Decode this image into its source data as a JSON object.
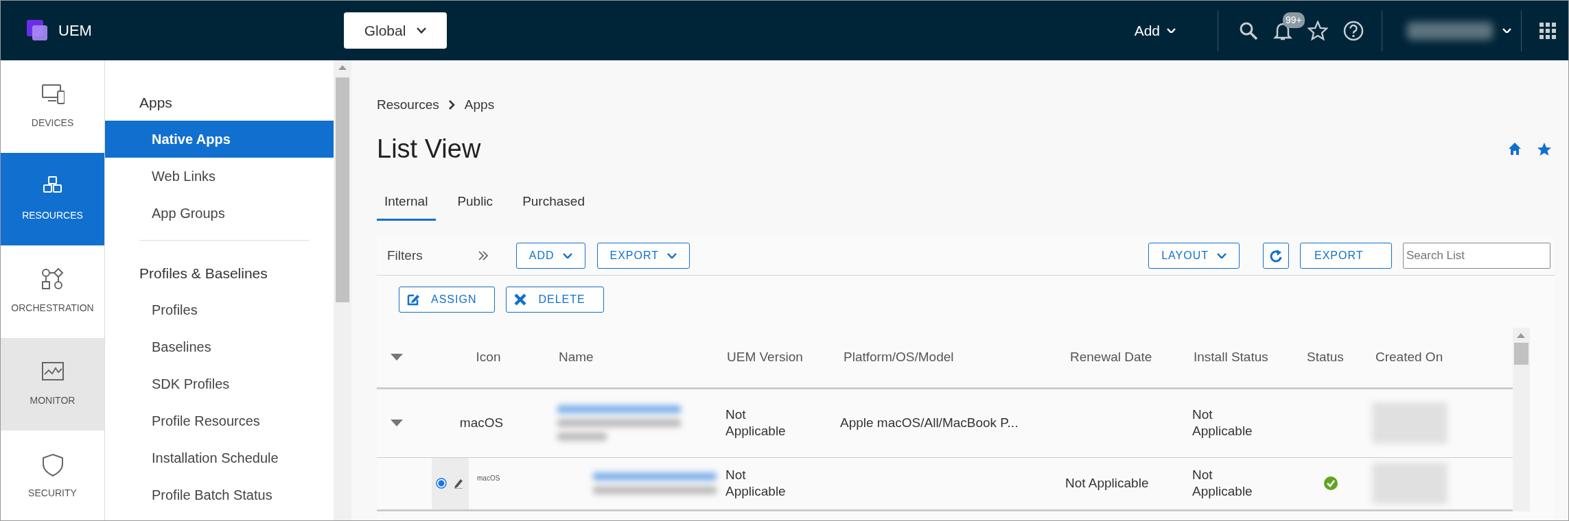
{
  "header": {
    "logo_text": "UEM",
    "scope": "Global",
    "add_menu": "Add",
    "notification_count": "99+"
  },
  "rail": [
    {
      "kind": "devices",
      "label": "DEVICES",
      "selected": false,
      "highlighted": false
    },
    {
      "kind": "resources",
      "label": "RESOURCES",
      "selected": true,
      "highlighted": false
    },
    {
      "kind": "orchestration",
      "label": "ORCHESTRATION",
      "selected": false,
      "highlighted": false
    },
    {
      "kind": "monitor",
      "label": "MONITOR",
      "selected": false,
      "highlighted": true
    },
    {
      "kind": "security",
      "label": "SECURITY",
      "selected": false,
      "highlighted": false
    }
  ],
  "submenu": [
    {
      "kind": "heading",
      "label": "Apps"
    },
    {
      "kind": "item",
      "label": "Native Apps",
      "selected": true
    },
    {
      "kind": "item",
      "label": "Web Links",
      "selected": false
    },
    {
      "kind": "item",
      "label": "App Groups",
      "selected": false
    },
    {
      "kind": "divider"
    },
    {
      "kind": "heading",
      "label": "Profiles & Baselines"
    },
    {
      "kind": "item",
      "label": "Profiles",
      "selected": false
    },
    {
      "kind": "item",
      "label": "Baselines",
      "selected": false
    },
    {
      "kind": "item",
      "label": "SDK Profiles",
      "selected": false
    },
    {
      "kind": "item",
      "label": "Profile Resources",
      "selected": false
    },
    {
      "kind": "item",
      "label": "Installation Schedule",
      "selected": false
    },
    {
      "kind": "item",
      "label": "Profile Batch Status",
      "selected": false
    }
  ],
  "breadcrumb": [
    "Resources",
    "Apps"
  ],
  "page_title": "List View",
  "tabs": [
    {
      "label": "Internal",
      "selected": true
    },
    {
      "label": "Public",
      "selected": false
    },
    {
      "label": "Purchased",
      "selected": false
    }
  ],
  "toolbar": {
    "filters_label": "Filters",
    "left_buttons": [
      {
        "kind": "dropdown",
        "label": "ADD"
      },
      {
        "kind": "dropdown",
        "label": "EXPORT"
      }
    ],
    "right_buttons": [
      {
        "kind": "dropdown",
        "label": "LAYOUT"
      },
      {
        "kind": "refresh"
      },
      {
        "kind": "plain",
        "label": "EXPORT"
      }
    ],
    "search": {
      "placeholder": "Search List"
    }
  },
  "actions": [
    {
      "kind": "edit",
      "label": "ASSIGN"
    },
    {
      "kind": "delete",
      "label": "DELETE"
    }
  ],
  "table": {
    "columns": [
      "Icon",
      "Name",
      "UEM Version",
      "Platform/OS/Model",
      "Renewal Date",
      "Install Status",
      "Status",
      "Created On"
    ],
    "rows": [
      {
        "kind": "group",
        "expanded": true,
        "icon_label": "macOS",
        "uem_version": "Not Applicable",
        "platform": "Apple macOS/All/MacBook P...",
        "install_status": "Not Applicable"
      },
      {
        "kind": "app",
        "selected": true,
        "icon_label": "macOS",
        "uem_version": "Not Applicable",
        "renewal_date": "Not Applicable",
        "install_status": "Not Applicable",
        "status_ok": true
      }
    ]
  }
}
